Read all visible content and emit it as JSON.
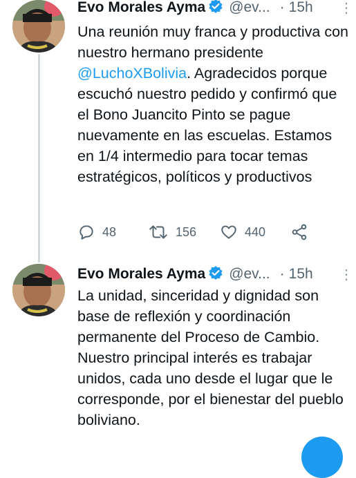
{
  "tweets": [
    {
      "author_name": "Evo Morales Ayma",
      "handle": "@ev...",
      "dot": "·",
      "time": "15h",
      "more_icon": "⋮",
      "text_before": "Una reunión muy franca y productiva con nuestro hermano presidente ",
      "mention": "@LuchoXBolivia",
      "text_after": ". Agradecidos porque escuchó nuestro pedido y confirmó que el Bono Juancito Pinto se pague nuevamente en las escuelas. Estamos en 1/4 intermedio para tocar temas estratégicos, políticos y productivos",
      "reply_count": "48",
      "retweet_count": "156",
      "like_count": "440"
    },
    {
      "author_name": "Evo Morales Ayma",
      "handle": "@ev...",
      "dot": "·",
      "time": "15h",
      "more_icon": "⋮",
      "text": "La unidad, sinceridad y dignidad son base de reflexión y coordinación permanente del Proceso de Cambio. Nuestro principal interés es trabajar unidos, cada uno desde el lugar que le corresponde, por el bienestar del pueblo boliviano."
    }
  ],
  "colors": {
    "accent": "#1d9bf0",
    "text": "#0f1419",
    "secondary": "#536471",
    "thread": "#cfd9de"
  },
  "icons": [
    "verified-badge-icon",
    "more-icon",
    "reply-icon",
    "retweet-icon",
    "like-icon",
    "share-icon"
  ]
}
